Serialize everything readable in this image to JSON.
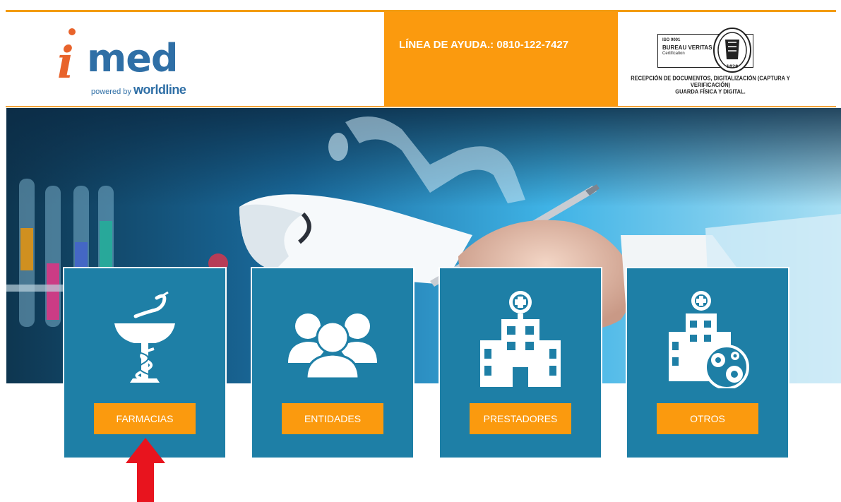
{
  "header": {
    "logo": {
      "brand_i": "i",
      "brand_rest": "med",
      "powered_by": "powered by",
      "partner": "worldline"
    },
    "helpline_text": "LÍNEA DE AYUDA.: 0810-122-7427",
    "certification": {
      "iso": "ISO 9001",
      "company": "BUREAU VERITAS",
      "label": "Certification",
      "seal_year": "1828",
      "description_line1": "RECEPCIÓN DE DOCUMENTOS, DIGITALIZACIÓN (CAPTURA Y VERIFICACIÓN)",
      "description_line2": "GUARDA FÍSICA Y DIGITAL."
    }
  },
  "categories": [
    {
      "icon": "caduceus-pharmacy-icon",
      "button_label": "FARMACIAS"
    },
    {
      "icon": "people-group-icon",
      "button_label": "ENTIDADES"
    },
    {
      "icon": "hospital-icon",
      "button_label": "PRESTADORES"
    },
    {
      "icon": "hospital-gears-icon",
      "button_label": "OTROS"
    }
  ],
  "colors": {
    "orange": "#fb9a0e",
    "card_blue": "#1e7fa6",
    "logo_orange": "#e8632b",
    "logo_blue": "#2f6fa6",
    "annotation_red": "#e8141e"
  }
}
